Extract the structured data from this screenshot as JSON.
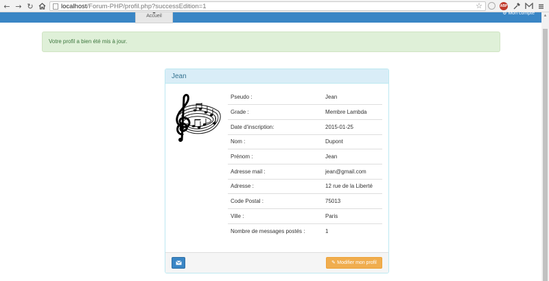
{
  "browser": {
    "url_host": "localhost",
    "url_path": "/Forum-PHP/profil.php?successEdition=1",
    "abp_label": "ABP"
  },
  "navbar": {
    "active_tab": "Accueil",
    "account_label": "Mon compte"
  },
  "alert": {
    "message": "Votre profil a bien été mis à jour."
  },
  "profile": {
    "heading": "Jean",
    "rows": [
      {
        "label": "Pseudo :",
        "value": "Jean"
      },
      {
        "label": "Grade :",
        "value": "Membre Lambda"
      },
      {
        "label": "Date d'inscription:",
        "value": "2015-01-25"
      },
      {
        "label": "Nom :",
        "value": "Dupont"
      },
      {
        "label": "Prénom :",
        "value": "Jean"
      },
      {
        "label": "Adresse mail :",
        "value": "jean@gmail.com"
      },
      {
        "label": "Adresse :",
        "value": "12 rue de la Liberté"
      },
      {
        "label": "Code Postal :",
        "value": "75013"
      },
      {
        "label": "Ville :",
        "value": "Paris"
      },
      {
        "label": "Nombre de messages postés :",
        "value": "1"
      }
    ],
    "edit_button_label": "Modifier mon profil"
  },
  "colors": {
    "navbar": "#3a86c5",
    "alert_bg": "#dff0d8",
    "alert_text": "#3c763d",
    "panel_heading_bg": "#d9edf7",
    "edit_button": "#f0ad4e"
  }
}
